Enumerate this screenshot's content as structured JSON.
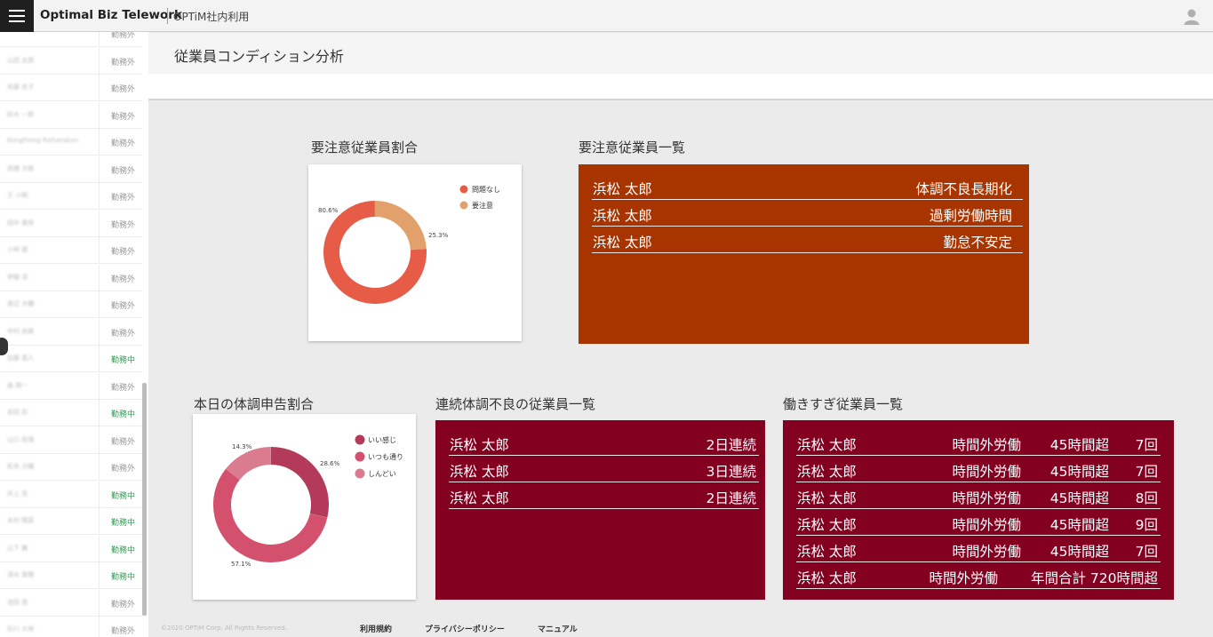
{
  "app": {
    "title": "Optimal Biz Telework",
    "subtitle": "OPTiM社内利用"
  },
  "page": {
    "title": "従業員コンディション分析"
  },
  "colors": {
    "warning_panel": "#a83500",
    "condition_panel": "#830021",
    "donut1": [
      "#e65c47",
      "#e2a06b"
    ],
    "donut2": [
      "#b33b59",
      "#d4516d",
      "#da7b8f"
    ],
    "status_active": "#2aa050"
  },
  "sidebar": {
    "items": [
      {
        "name": "",
        "status": "勤務外"
      },
      {
        "name": "山田 太郎",
        "status": "勤務外"
      },
      {
        "name": "佐藤 花子",
        "status": "勤務外"
      },
      {
        "name": "鈴木 一郎",
        "status": "勤務外"
      },
      {
        "name": "Kongthong Rattanakan",
        "status": "勤務外"
      },
      {
        "name": "高橋 次郎",
        "status": "勤務外"
      },
      {
        "name": "王 小明",
        "status": "勤務外"
      },
      {
        "name": "田中 美咲",
        "status": "勤務外"
      },
      {
        "name": "小林 健",
        "status": "勤務外"
      },
      {
        "name": "伊藤 涼",
        "status": "勤務外"
      },
      {
        "name": "渡辺 大輔",
        "status": "勤務外"
      },
      {
        "name": "中村 由美",
        "status": "勤務外"
      },
      {
        "name": "加藤 直人",
        "status": "勤務中"
      },
      {
        "name": "森 翔一",
        "status": "勤務外"
      },
      {
        "name": "吉田 彩",
        "status": "勤務中"
      },
      {
        "name": "山口 拓海",
        "status": "勤務外"
      },
      {
        "name": "松本 沙織",
        "status": "勤務外"
      },
      {
        "name": "井上 亮",
        "status": "勤務中"
      },
      {
        "name": "木村 陽菜",
        "status": "勤務中"
      },
      {
        "name": "山下 翼",
        "status": "勤務中"
      },
      {
        "name": "清水 美穂",
        "status": "勤務中"
      },
      {
        "name": "池田 悠",
        "status": "勤務外"
      },
      {
        "name": "石川 大地",
        "status": "勤務外"
      }
    ]
  },
  "warning_ratio": {
    "title": "要注意従業員割合",
    "legend": [
      "問題なし",
      "要注意"
    ],
    "labels": [
      "80.6%",
      "25.3%"
    ]
  },
  "warning_list": {
    "title": "要注意従業員一覧",
    "rows": [
      {
        "name": "浜松 太郎",
        "reason": "体調不良長期化"
      },
      {
        "name": "浜松 太郎",
        "reason": "過剰労働時間"
      },
      {
        "name": "浜松 太郎",
        "reason": "勤怠不安定"
      }
    ]
  },
  "report_ratio": {
    "title": "本日の体調申告割合",
    "legend": [
      "いい感じ",
      "いつも通り",
      "しんどい"
    ],
    "labels": [
      "28.6%",
      "57.1%",
      "14.3%"
    ]
  },
  "condition_list": {
    "title": "連続体調不良の従業員一覧",
    "rows": [
      {
        "name": "浜松 太郎",
        "days": "2日連続"
      },
      {
        "name": "浜松 太郎",
        "days": "3日連続"
      },
      {
        "name": "浜松 太郎",
        "days": "2日連続"
      }
    ]
  },
  "overwork_list": {
    "title": "働きすぎ従業員一覧",
    "rows": [
      {
        "name": "浜松 太郎",
        "type": "時間外労働",
        "hours": "45時間超",
        "count": "7回"
      },
      {
        "name": "浜松 太郎",
        "type": "時間外労働",
        "hours": "45時間超",
        "count": "7回"
      },
      {
        "name": "浜松 太郎",
        "type": "時間外労働",
        "hours": "45時間超",
        "count": "8回"
      },
      {
        "name": "浜松 太郎",
        "type": "時間外労働",
        "hours": "45時間超",
        "count": "9回"
      },
      {
        "name": "浜松 太郎",
        "type": "時間外労働",
        "hours": "45時間超",
        "count": "7回"
      },
      {
        "name": "浜松 太郎",
        "type": "時間外労働",
        "hours": "年間合計 720時間超",
        "count": ""
      }
    ]
  },
  "footer": {
    "copyright": "©2020 OPTiM Corp. All Rights Reserved.",
    "links": [
      "利用規約",
      "プライバシーポリシー",
      "マニュアル"
    ]
  }
}
